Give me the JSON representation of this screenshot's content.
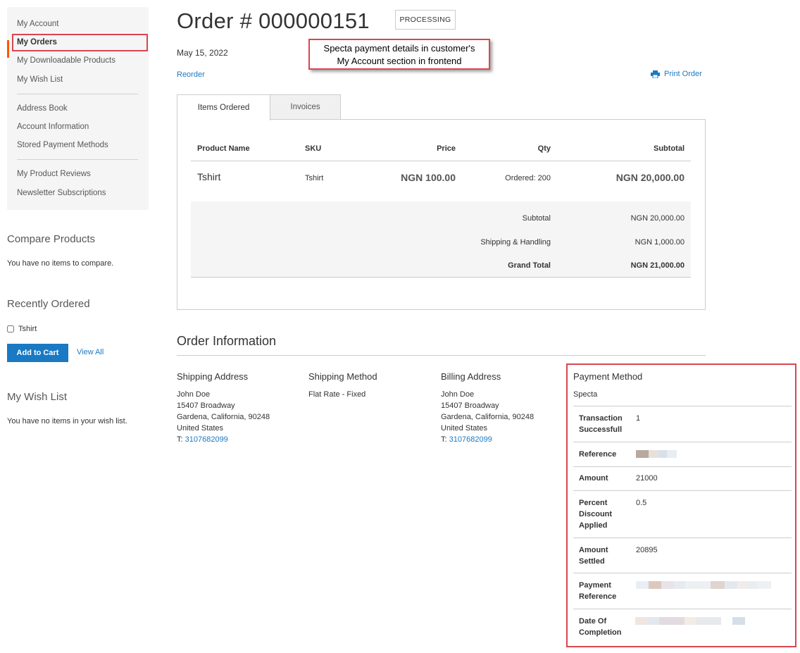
{
  "sidebar": {
    "nav": [
      {
        "label": "My Account"
      },
      {
        "label": "My Orders"
      },
      {
        "label": "My Downloadable Products"
      },
      {
        "label": "My Wish List"
      },
      {
        "label": "Address Book"
      },
      {
        "label": "Account Information"
      },
      {
        "label": "Stored Payment Methods"
      },
      {
        "label": "My Product Reviews"
      },
      {
        "label": "Newsletter Subscriptions"
      }
    ],
    "compare": {
      "title": "Compare Products",
      "empty": "You have no items to compare."
    },
    "recent": {
      "title": "Recently Ordered",
      "item": "Tshirt",
      "add_to_cart": "Add to Cart",
      "view_all": "View All"
    },
    "wishlist": {
      "title": "My Wish List",
      "empty": "You have no items in your wish list."
    }
  },
  "order": {
    "title": "Order # 000000151",
    "status": "PROCESSING",
    "date": "May 15, 2022",
    "reorder": "Reorder",
    "print": "Print Order"
  },
  "callout": {
    "line1": "Specta payment details in customer's",
    "line2": "My Account section in frontend"
  },
  "tabs": [
    {
      "label": "Items Ordered"
    },
    {
      "label": "Invoices"
    }
  ],
  "items_table": {
    "headers": {
      "name": "Product Name",
      "sku": "SKU",
      "price": "Price",
      "qty": "Qty",
      "subtotal": "Subtotal"
    },
    "row": {
      "name": "Tshirt",
      "sku": "Tshirt",
      "price": "NGN 100.00",
      "qty": "Ordered: 200",
      "subtotal": "NGN 20,000.00"
    },
    "totals": [
      {
        "label": "Subtotal",
        "value": "NGN 20,000.00"
      },
      {
        "label": "Shipping & Handling",
        "value": "NGN 1,000.00"
      },
      {
        "label": "Grand Total",
        "value": "NGN 21,000.00"
      }
    ]
  },
  "order_info": {
    "title": "Order Information",
    "shipping_address": {
      "title": "Shipping Address",
      "name": "John Doe",
      "street": "15407 Broadway",
      "city": "Gardena, California, 90248",
      "country": "United States",
      "phone_prefix": "T: ",
      "phone": "3107682099"
    },
    "shipping_method": {
      "title": "Shipping Method",
      "value": "Flat Rate - Fixed"
    },
    "billing_address": {
      "title": "Billing Address",
      "name": "John Doe",
      "street": "15407 Broadway",
      "city": "Gardena, California, 90248",
      "country": "United States",
      "phone_prefix": "T: ",
      "phone": "3107682099"
    },
    "payment_method": {
      "title": "Payment Method",
      "name": "Specta",
      "rows": [
        {
          "label_lines": [
            "Transaction",
            "Successfull"
          ],
          "value": "1"
        },
        {
          "label_lines": [
            "Reference"
          ],
          "value": ""
        },
        {
          "label_lines": [
            "Amount"
          ],
          "value": "21000"
        },
        {
          "label_lines": [
            "Percent",
            "Discount",
            "Applied"
          ],
          "value": "0.5"
        },
        {
          "label_lines": [
            "Amount",
            "Settled"
          ],
          "value": "20895"
        },
        {
          "label_lines": [
            "Payment",
            "Reference"
          ],
          "value": ""
        },
        {
          "label_lines": [
            "Date Of",
            "Completion"
          ],
          "value": ""
        }
      ]
    }
  },
  "colors": {
    "link": "#1979c3",
    "primary_button": "#1979c3",
    "highlight_border": "#d9464f",
    "nav_active": "#ff5501"
  }
}
